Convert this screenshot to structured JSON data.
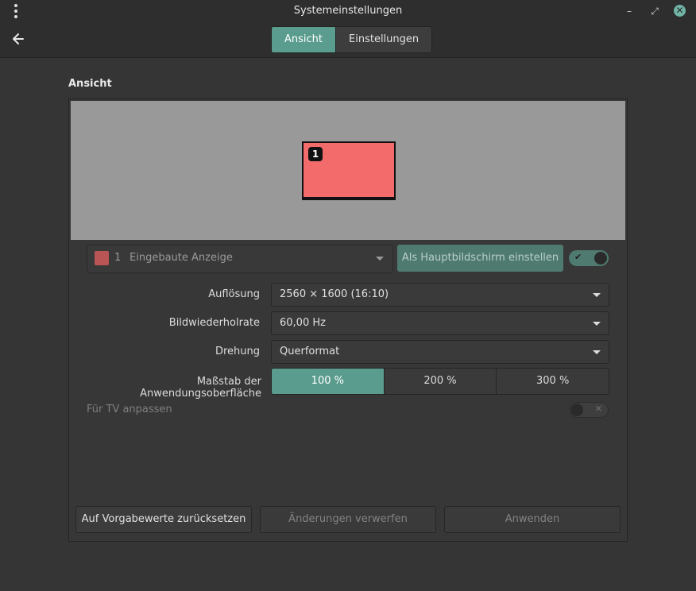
{
  "window": {
    "title": "Systemeinstellungen",
    "minimize_glyph": "–",
    "maximize_glyph": "⤢",
    "close_glyph": "✕"
  },
  "tabs": [
    {
      "label": "Ansicht",
      "active": true
    },
    {
      "label": "Einstellungen",
      "active": false
    }
  ],
  "section": {
    "title": "Ansicht"
  },
  "preview": {
    "monitor_number": "1",
    "monitor_color": "#f36b6b"
  },
  "display_select": {
    "number": "1",
    "name": "Eingebaute Anzeige",
    "swatch_color": "#b95555"
  },
  "primary_button": {
    "label": "Als Hauptbildschirm einstellen"
  },
  "enabled_toggle": {
    "on": true,
    "glyph": "✔"
  },
  "settings": {
    "resolution": {
      "label": "Auflösung",
      "value": "2560 × 1600 (16:10)"
    },
    "refresh": {
      "label": "Bildwiederholrate",
      "value": "60,00 Hz"
    },
    "rotation": {
      "label": "Drehung",
      "value": "Querformat"
    },
    "scale": {
      "label": "Maßstab der Anwendungsoberfläche",
      "options": [
        "100 %",
        "200 %",
        "300 %"
      ],
      "selected": "100 %"
    },
    "tv": {
      "label": "Für TV anpassen",
      "on": false,
      "glyph": "✕"
    }
  },
  "buttons": {
    "reset": "Auf Vorgabewerte zurücksetzen",
    "discard": "Änderungen verwerfen",
    "apply": "Anwenden"
  },
  "colors": {
    "accent": "#5a9c8e",
    "accent_dim": "#4f7a70",
    "close": "#6fb4a4"
  },
  "icons": [
    "menu-icon",
    "back-arrow-icon",
    "minimize-icon",
    "maximize-icon",
    "close-icon",
    "chevron-down-icon",
    "check-icon",
    "x-icon"
  ]
}
